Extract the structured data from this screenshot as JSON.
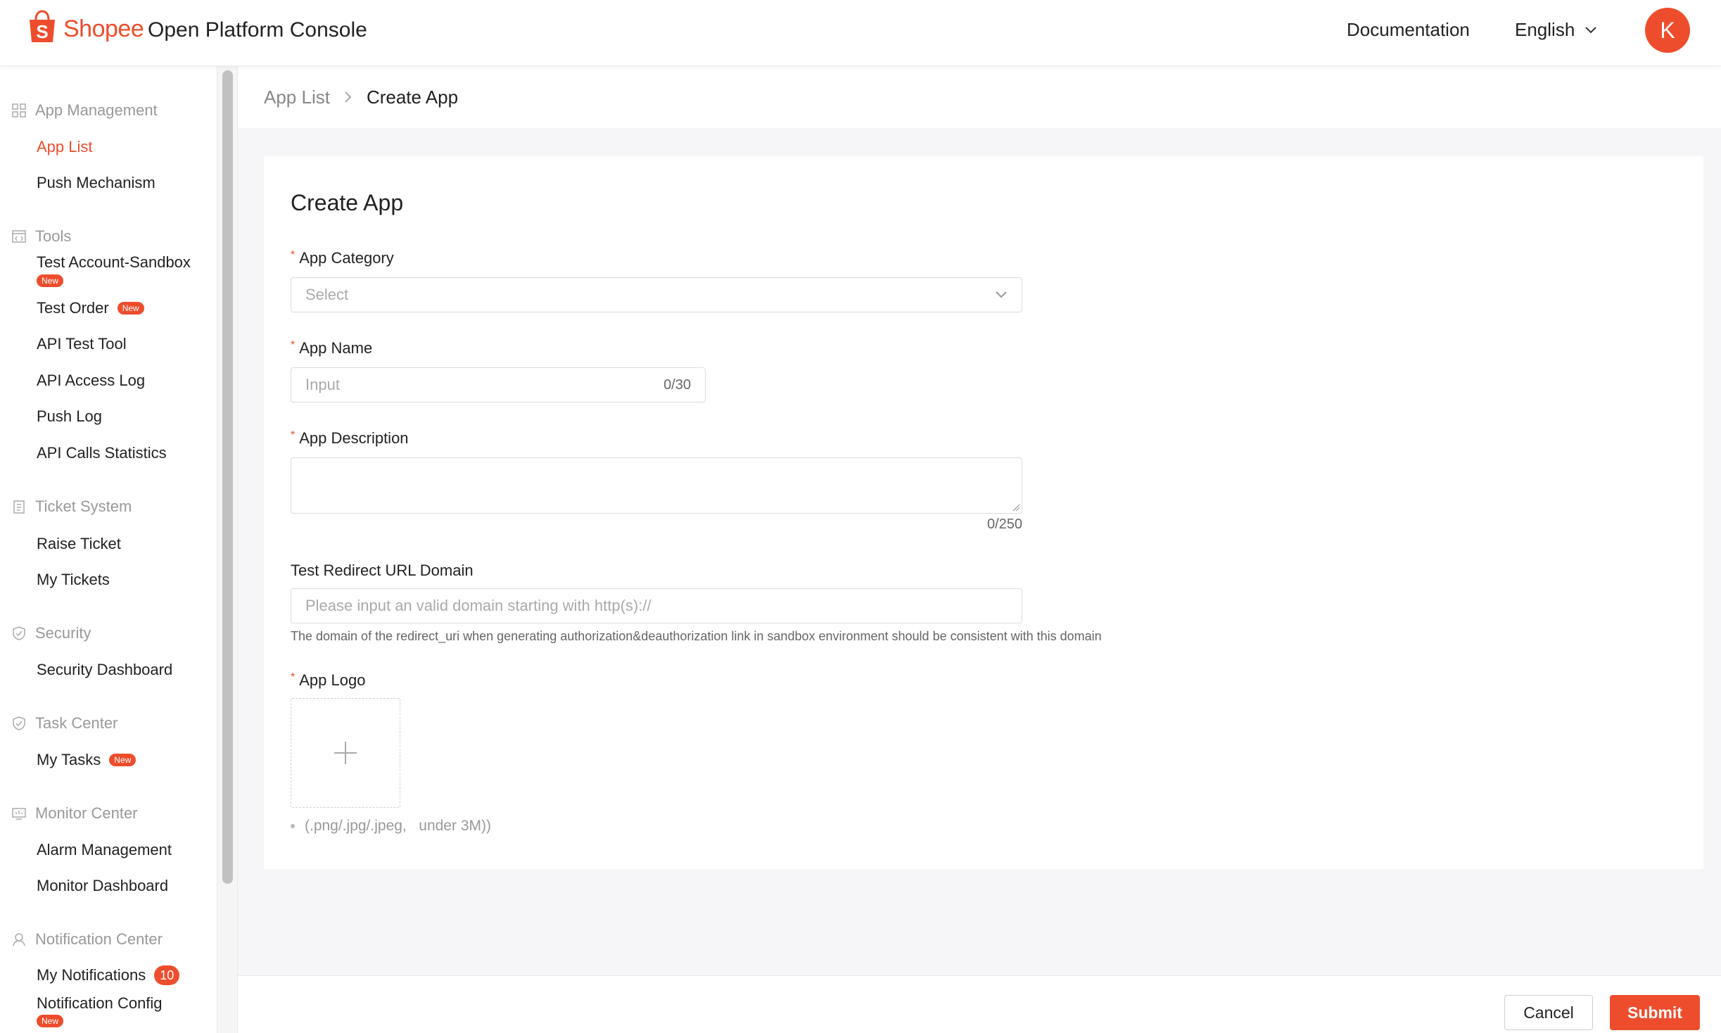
{
  "header": {
    "brand": "Shopee",
    "product": "Open Platform Console",
    "documentation": "Documentation",
    "language": "English",
    "avatar_initial": "K",
    "accent_color": "#ee4d2d"
  },
  "sidebar": {
    "groups": [
      {
        "title": "App Management",
        "icon": "grid-icon",
        "items": [
          {
            "label": "App List",
            "active": true
          },
          {
            "label": "Push Mechanism"
          }
        ]
      },
      {
        "title": "Tools",
        "icon": "code-window-icon",
        "items": [
          {
            "label": "Test Account-Sandbox",
            "badge": "New"
          },
          {
            "label": "Test Order",
            "badge": "New"
          },
          {
            "label": "API Test Tool"
          },
          {
            "label": "API Access Log"
          },
          {
            "label": "Push Log"
          },
          {
            "label": "API Calls Statistics"
          }
        ]
      },
      {
        "title": "Ticket System",
        "icon": "clipboard-icon",
        "items": [
          {
            "label": "Raise Ticket"
          },
          {
            "label": "My Tickets"
          }
        ]
      },
      {
        "title": "Security",
        "icon": "shield-icon",
        "items": [
          {
            "label": "Security Dashboard"
          }
        ]
      },
      {
        "title": "Task Center",
        "icon": "shield-check-icon",
        "items": [
          {
            "label": "My Tasks",
            "badge": "New"
          }
        ]
      },
      {
        "title": "Monitor Center",
        "icon": "monitor-icon",
        "items": [
          {
            "label": "Alarm Management"
          },
          {
            "label": "Monitor Dashboard"
          }
        ]
      },
      {
        "title": "Notification Center",
        "icon": "user-icon",
        "items": [
          {
            "label": "My Notifications",
            "count": "10"
          },
          {
            "label": "Notification Config",
            "badge": "New"
          }
        ]
      }
    ]
  },
  "breadcrumb": {
    "parent": "App List",
    "current": "Create App"
  },
  "form": {
    "title": "Create App",
    "required_mark": "*",
    "category": {
      "label": "App Category",
      "placeholder": "Select"
    },
    "name": {
      "label": "App Name",
      "placeholder": "Input",
      "counter": "0/30"
    },
    "description": {
      "label": "App Description",
      "counter": "0/250"
    },
    "redirect": {
      "label": "Test Redirect URL Domain",
      "placeholder": "Please input an valid domain starting with http(s)://",
      "help": "The domain of the redirect_uri when generating authorization&deauthorization link in sandbox environment should be consistent with this domain"
    },
    "logo": {
      "label": "App Logo",
      "hint": "(.png/.jpg/.jpeg,   under 3M))"
    }
  },
  "footer": {
    "cancel": "Cancel",
    "submit": "Submit"
  }
}
